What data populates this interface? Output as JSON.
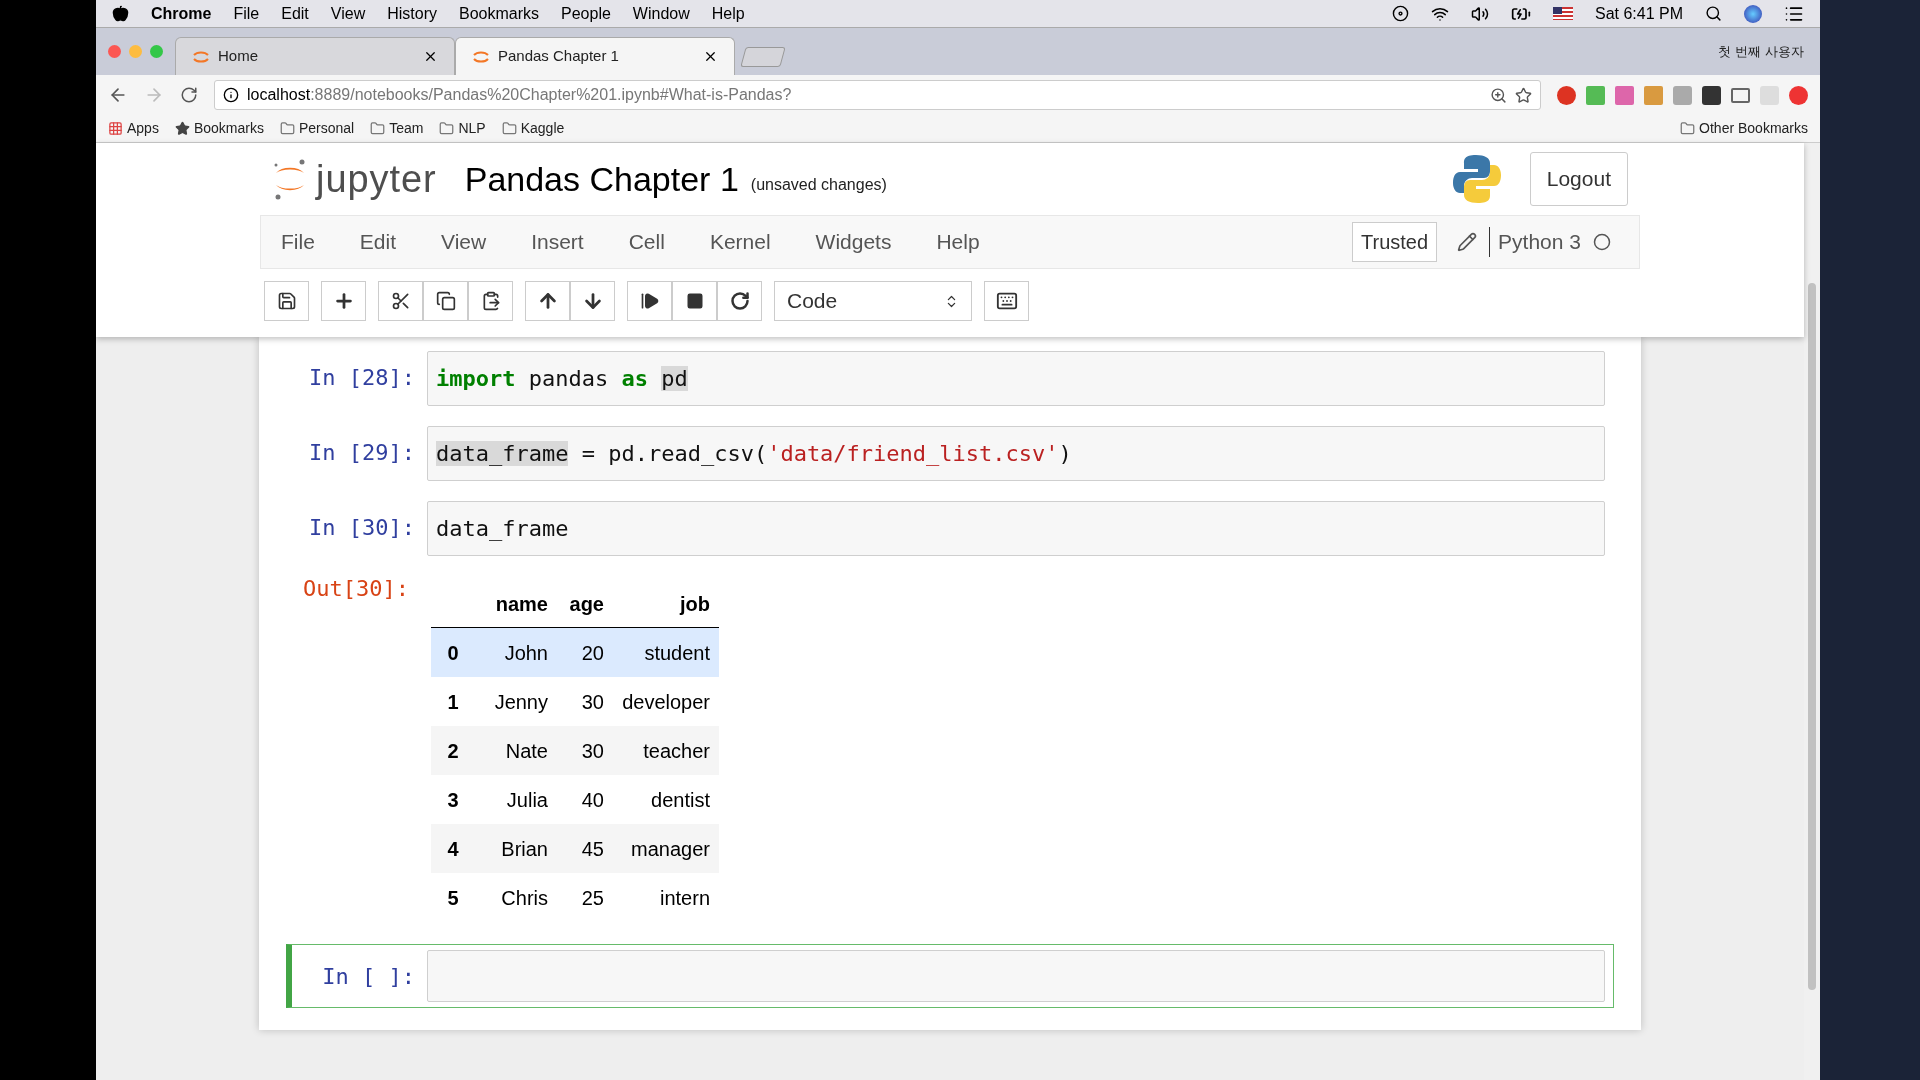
{
  "mac_menubar": {
    "menus": [
      "Chrome",
      "File",
      "Edit",
      "View",
      "History",
      "Bookmarks",
      "People",
      "Window",
      "Help"
    ],
    "clock": "Sat 6:41 PM"
  },
  "browser": {
    "tabs": [
      {
        "title": "Home",
        "selected": false
      },
      {
        "title": "Pandas Chapter 1",
        "selected": true
      }
    ],
    "profile": "첫 번째 사용자",
    "address": {
      "host": "localhost",
      "path": ":8889/notebooks/Pandas%20Chapter%201.ipynb#What-is-Pandas?"
    },
    "bookmarks": [
      {
        "label": "Apps",
        "kind": "apps"
      },
      {
        "label": "Bookmarks",
        "kind": "star"
      },
      {
        "label": "Personal",
        "kind": "folder"
      },
      {
        "label": "Team",
        "kind": "folder"
      },
      {
        "label": "NLP",
        "kind": "folder"
      },
      {
        "label": "Kaggle",
        "kind": "folder"
      }
    ],
    "other_bookmarks": "Other Bookmarks"
  },
  "jupyter": {
    "logo_text": "jupyter",
    "title": "Pandas Chapter 1",
    "save_status": "(unsaved changes)",
    "logout": "Logout",
    "menu": [
      "File",
      "Edit",
      "View",
      "Insert",
      "Cell",
      "Kernel",
      "Widgets",
      "Help"
    ],
    "trusted": "Trusted",
    "kernel": "Python 3",
    "cell_type": "Code"
  },
  "cells": [
    {
      "prompt": "In [28]:",
      "selected": false,
      "tokens": [
        {
          "text": "import",
          "kind": "keyword"
        },
        {
          "text": " pandas ",
          "kind": "plain"
        },
        {
          "text": "as ",
          "kind": "keyword"
        },
        {
          "text": "pd",
          "kind": "match"
        }
      ]
    },
    {
      "prompt": "In [29]:",
      "selected": false,
      "tokens": [
        {
          "text": "data_frame",
          "kind": "match"
        },
        {
          "text": " = pd.read_csv(",
          "kind": "plain"
        },
        {
          "text": "'data/friend_list.csv'",
          "kind": "string"
        },
        {
          "text": ")",
          "kind": "plain"
        }
      ]
    },
    {
      "prompt": "In [30]:",
      "selected": false,
      "tokens": [
        {
          "text": "data_frame",
          "kind": "plain"
        }
      ],
      "output": {
        "prompt": "Out[30]:",
        "columns": [
          "name",
          "age",
          "job"
        ],
        "rows": [
          {
            "index": "0",
            "cells": [
              "John",
              "20",
              "student"
            ],
            "highlighted": true
          },
          {
            "index": "1",
            "cells": [
              "Jenny",
              "30",
              "developer"
            ],
            "highlighted": false
          },
          {
            "index": "2",
            "cells": [
              "Nate",
              "30",
              "teacher"
            ],
            "highlighted": false
          },
          {
            "index": "3",
            "cells": [
              "Julia",
              "40",
              "dentist"
            ],
            "highlighted": false
          },
          {
            "index": "4",
            "cells": [
              "Brian",
              "45",
              "manager"
            ],
            "highlighted": false
          },
          {
            "index": "5",
            "cells": [
              "Chris",
              "25",
              "intern"
            ],
            "highlighted": false
          }
        ]
      }
    },
    {
      "prompt": "In [ ]:",
      "selected": true
    }
  ]
}
